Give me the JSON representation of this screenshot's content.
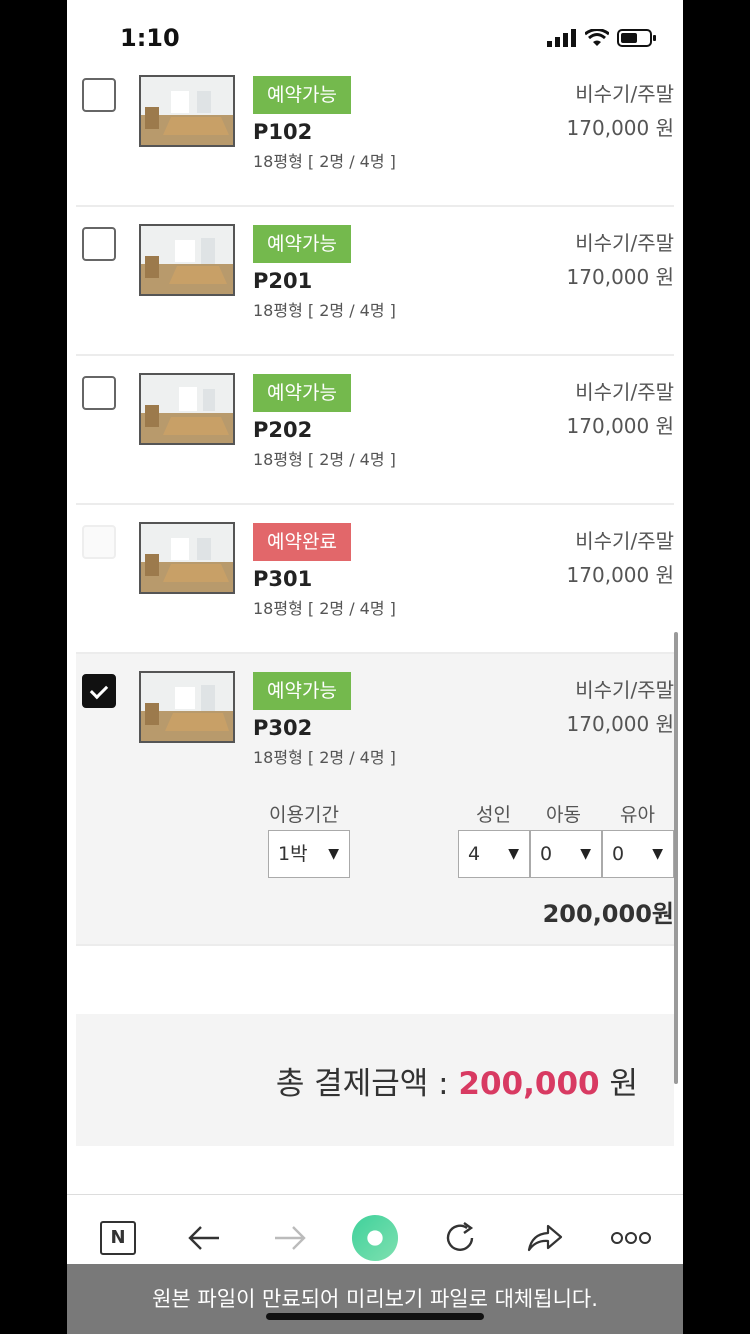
{
  "status": {
    "time": "1:10"
  },
  "rooms": [
    {
      "status": "예약가능",
      "name": "P102",
      "spec": "18평형 [ 2명 / 4명 ]",
      "season": "비수기/주말",
      "price": "170,000 원"
    },
    {
      "status": "예약가능",
      "name": "P201",
      "spec": "18평형 [ 2명 / 4명 ]",
      "season": "비수기/주말",
      "price": "170,000 원"
    },
    {
      "status": "예약가능",
      "name": "P202",
      "spec": "18평형 [ 2명 / 4명 ]",
      "season": "비수기/주말",
      "price": "170,000 원"
    },
    {
      "status": "예약완료",
      "name": "P301",
      "spec": "18평형 [ 2명 / 4명 ]",
      "season": "비수기/주말",
      "price": "170,000 원"
    },
    {
      "status": "예약가능",
      "name": "P302",
      "spec": "18평형 [ 2명 / 4명 ]",
      "season": "비수기/주말",
      "price": "170,000 원"
    }
  ],
  "options": {
    "period_label": "이용기간",
    "period_value": "1박",
    "adult_label": "성인",
    "adult_value": "4",
    "child_label": "아동",
    "child_value": "0",
    "infant_label": "유아",
    "infant_value": "0",
    "subtotal": "200,000원"
  },
  "total": {
    "label": "총 결제금액 : ",
    "amount": "200,000",
    "unit": " 원"
  },
  "toolbar": {
    "naver_label": "N",
    "icons": [
      "naver-icon",
      "back-icon",
      "forward-icon",
      "home-circle-icon",
      "reload-icon",
      "share-icon",
      "more-icon"
    ]
  },
  "toast": "원본 파일이 만료되어 미리보기 파일로 대체됩니다.",
  "colors": {
    "available": "#74b94d",
    "booked": "#e2676a",
    "total_amount": "#d83a62"
  }
}
